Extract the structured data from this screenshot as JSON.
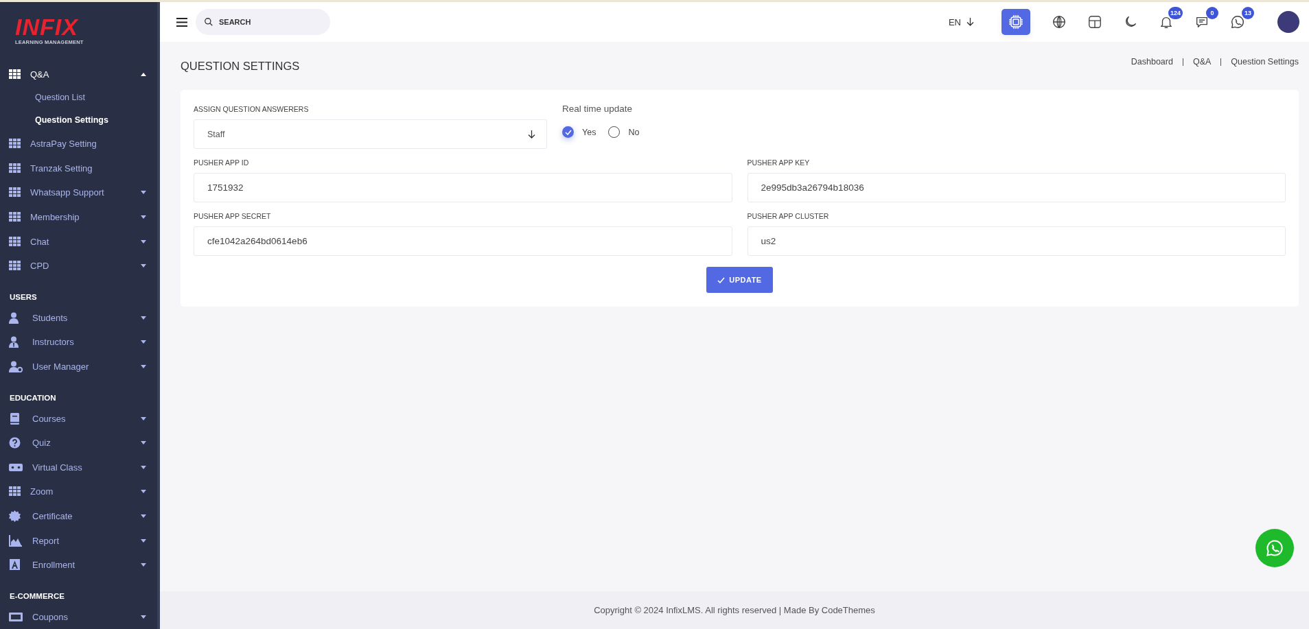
{
  "sidebar": {
    "logo": {
      "title": "INFIX",
      "subtitle": "LEARNING MANAGEMENT"
    },
    "sections": [
      {
        "items": [
          {
            "label": "Q&A",
            "active": true,
            "expanded": true,
            "children": [
              {
                "label": "Question List",
                "selected": false
              },
              {
                "label": "Question Settings",
                "selected": true
              }
            ]
          },
          {
            "label": "AstraPay Setting",
            "active": false
          },
          {
            "label": "Tranzak Setting",
            "active": false
          },
          {
            "label": "Whatsapp Support",
            "active": false,
            "expanded": false
          },
          {
            "label": "Membership",
            "active": false,
            "expanded": false
          },
          {
            "label": "Chat",
            "active": false,
            "expanded": false
          },
          {
            "label": "CPD",
            "active": false,
            "expanded": false
          }
        ]
      },
      {
        "heading": "USERS",
        "items": [
          {
            "label": "Students",
            "active": false,
            "expanded": false
          },
          {
            "label": "Instructors",
            "active": false,
            "expanded": false
          },
          {
            "label": "User Manager",
            "active": false,
            "expanded": false
          }
        ]
      },
      {
        "heading": "EDUCATION",
        "items": [
          {
            "label": "Courses",
            "active": false,
            "expanded": false
          },
          {
            "label": "Quiz",
            "active": false,
            "expanded": false
          },
          {
            "label": "Virtual Class",
            "active": false,
            "expanded": false
          },
          {
            "label": "Zoom",
            "active": false,
            "expanded": false
          },
          {
            "label": "Certificate",
            "active": false,
            "expanded": false
          },
          {
            "label": "Report",
            "active": false,
            "expanded": false
          },
          {
            "label": "Enrollment",
            "active": false,
            "expanded": false
          }
        ]
      },
      {
        "heading": "E-COMMERCE",
        "items": [
          {
            "label": "Coupons",
            "active": false,
            "expanded": false
          }
        ]
      }
    ]
  },
  "header": {
    "search": {
      "placeholder": "SEARCH"
    },
    "language": "EN",
    "notifications": "124",
    "messages": "0",
    "whatsapp": "13"
  },
  "page": {
    "title": "QUESTION SETTINGS",
    "breadcrumbs": [
      "Dashboard",
      "Q&A",
      "Question Settings"
    ]
  },
  "form": {
    "assign": {
      "label": "ASSIGN QUESTION ANSWERERS",
      "value": "Staff"
    },
    "real_time": {
      "label": "Real time update",
      "options": [
        {
          "label": "Yes",
          "selected": true
        },
        {
          "label": "No",
          "selected": false
        }
      ]
    },
    "fields": [
      {
        "label": "PUSHER APP ID",
        "value": "1751932"
      },
      {
        "label": "PUSHER APP KEY",
        "value": "2e995db3a26794b18036"
      },
      {
        "label": "PUSHER APP SECRET",
        "value": "cfe1042a264bd0614eb6"
      },
      {
        "label": "PUSHER APP CLUSTER",
        "value": "us2"
      }
    ],
    "submit": "UPDATE"
  },
  "footer": "Copyright © 2024 InfixLMS. All rights reserved | Made By CodeThemes"
}
